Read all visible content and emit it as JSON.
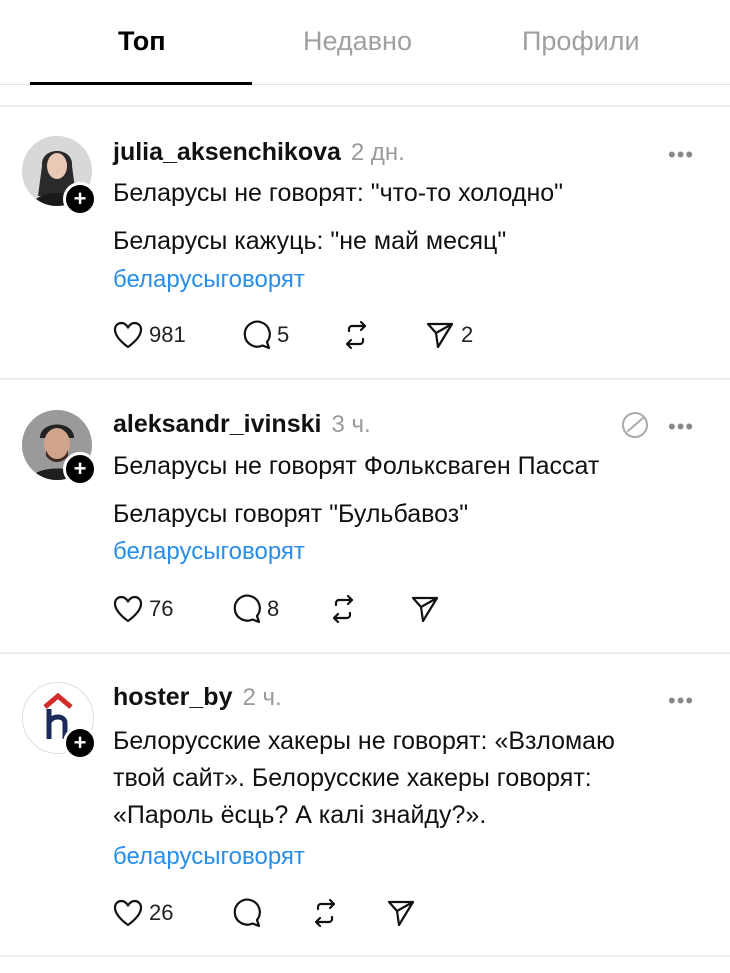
{
  "tabs": [
    {
      "label": "Топ",
      "active": true
    },
    {
      "label": "Недавно",
      "active": false
    },
    {
      "label": "Профили",
      "active": false
    }
  ],
  "posts": [
    {
      "username": "julia_aksenchikova",
      "time": "2 дн.",
      "lines": [
        "Беларусы не говорят: \"что-то холодно\"",
        "Беларусы кажуць: \"не май месяц\""
      ],
      "hashtag": "беларусыговорят",
      "likes": "981",
      "replies": "5",
      "reposts": "",
      "shares": "2"
    },
    {
      "username": "aleksandr_ivinski",
      "time": "3 ч.",
      "lines": [
        "Беларусы не говорят Фольксваген Пассат",
        "Беларусы говорят \"Бульбавоз\""
      ],
      "hashtag": "беларусыговорят",
      "likes": "76",
      "replies": "8",
      "reposts": "",
      "shares": ""
    },
    {
      "username": "hoster_by",
      "time": "2 ч.",
      "lines": [
        "Белорусские хакеры не говорят: «Взломаю",
        "твой сайт». Белорусские хакеры говорят:",
        "«Пароль ёсць? А калі знайду?»."
      ],
      "hashtag": "беларусыговорят",
      "likes": "26",
      "replies": "",
      "reposts": "",
      "shares": ""
    }
  ],
  "ui": {
    "more_label": "•••",
    "plus_label": "+",
    "link_color": "#2a8ee8"
  }
}
